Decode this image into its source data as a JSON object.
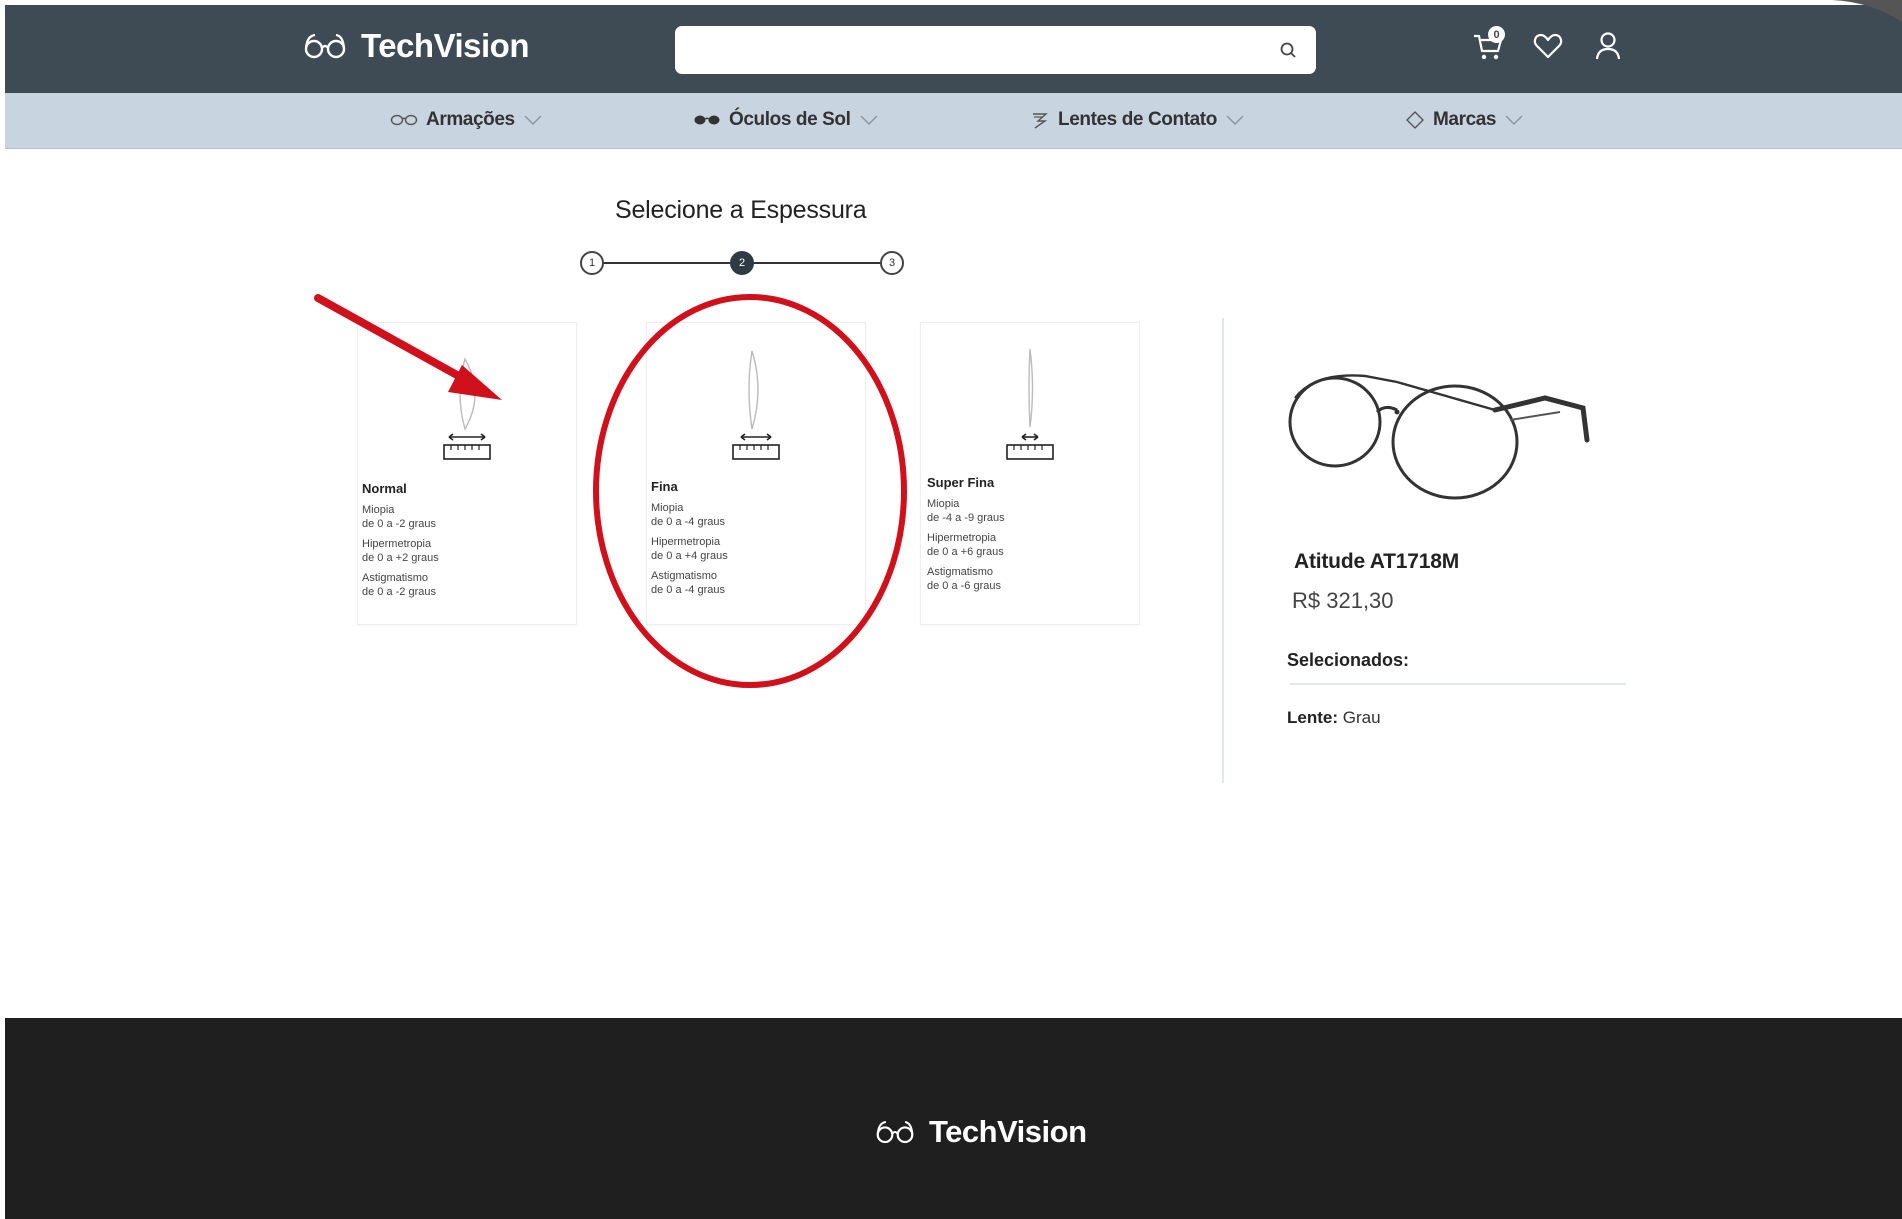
{
  "header": {
    "brand": "TechVision",
    "search_placeholder": "",
    "cart_count": "0"
  },
  "nav": [
    {
      "label": "Armações"
    },
    {
      "label": "Óculos de Sol"
    },
    {
      "label": "Lentes de Contato"
    },
    {
      "label": "Marcas"
    }
  ],
  "stepper": {
    "title": "Selecione a Espessura",
    "steps": [
      "1",
      "2",
      "3"
    ],
    "active_step": 2
  },
  "options": [
    {
      "name": "Normal",
      "specs": [
        {
          "label": "Miopia",
          "range": "de 0 a -2 graus"
        },
        {
          "label": "Hipermetropia",
          "range": "de 0 a +2 graus"
        },
        {
          "label": "Astigmatismo",
          "range": "de 0 a -2 graus"
        }
      ]
    },
    {
      "name": "Fina",
      "specs": [
        {
          "label": "Miopia",
          "range": "de 0 a -4 graus"
        },
        {
          "label": "Hipermetropia",
          "range": "de 0 a +4 graus"
        },
        {
          "label": "Astigmatismo",
          "range": "de 0 a -4 graus"
        }
      ]
    },
    {
      "name": "Super Fina",
      "specs": [
        {
          "label": "Miopia",
          "range": "de -4 a -9 graus"
        },
        {
          "label": "Hipermetropia",
          "range": "de 0 a +6 graus"
        },
        {
          "label": "Astigmatismo",
          "range": "de 0 a -6 graus"
        }
      ]
    }
  ],
  "product": {
    "name": "Atitude AT1718M",
    "price": "R$ 321,30",
    "selected_label": "Selecionados:",
    "lens_label": "Lente:",
    "lens_value": "Grau"
  },
  "footer": {
    "brand": "TechVision"
  },
  "colors": {
    "header_bg": "#3f4b54",
    "nav_bg": "#c8d4df",
    "footer_bg": "#1f1f1f",
    "annotation_red": "#d0111b"
  }
}
